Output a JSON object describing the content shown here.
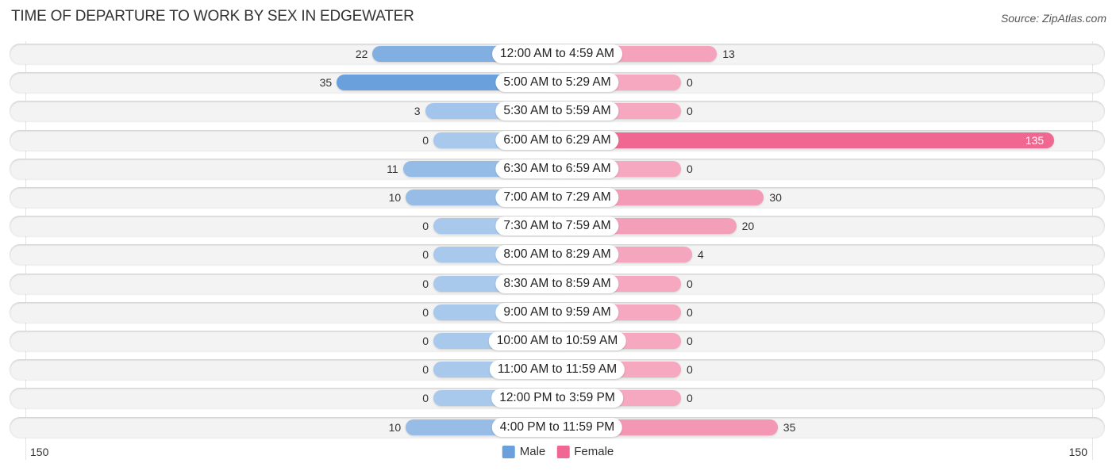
{
  "header": {
    "title": "TIME OF DEPARTURE TO WORK BY SEX IN EDGEWATER",
    "source": "Source: ZipAtlas.com"
  },
  "colors": {
    "male": "#6aa0dc",
    "male_light": "#a9c9ec",
    "female": "#f06892",
    "female_light": "#f5a8c0"
  },
  "chart_data": {
    "type": "bar",
    "orientation": "horizontal-diverging",
    "title": "TIME OF DEPARTURE TO WORK BY SEX IN EDGEWATER",
    "categories": [
      "12:00 AM to 4:59 AM",
      "5:00 AM to 5:29 AM",
      "5:30 AM to 5:59 AM",
      "6:00 AM to 6:29 AM",
      "6:30 AM to 6:59 AM",
      "7:00 AM to 7:29 AM",
      "7:30 AM to 7:59 AM",
      "8:00 AM to 8:29 AM",
      "8:30 AM to 8:59 AM",
      "9:00 AM to 9:59 AM",
      "10:00 AM to 10:59 AM",
      "11:00 AM to 11:59 AM",
      "12:00 PM to 3:59 PM",
      "4:00 PM to 11:59 PM"
    ],
    "series": [
      {
        "name": "Male",
        "values": [
          22,
          35,
          3,
          0,
          11,
          10,
          0,
          0,
          0,
          0,
          0,
          0,
          0,
          10
        ]
      },
      {
        "name": "Female",
        "values": [
          13,
          0,
          0,
          135,
          0,
          30,
          20,
          4,
          0,
          0,
          0,
          0,
          0,
          35
        ]
      }
    ],
    "xlim": [
      150,
      150
    ],
    "axis_labels": {
      "left": "150",
      "right": "150"
    },
    "legend": {
      "position": "bottom-center",
      "entries": [
        "Male",
        "Female"
      ]
    },
    "grid": false
  }
}
